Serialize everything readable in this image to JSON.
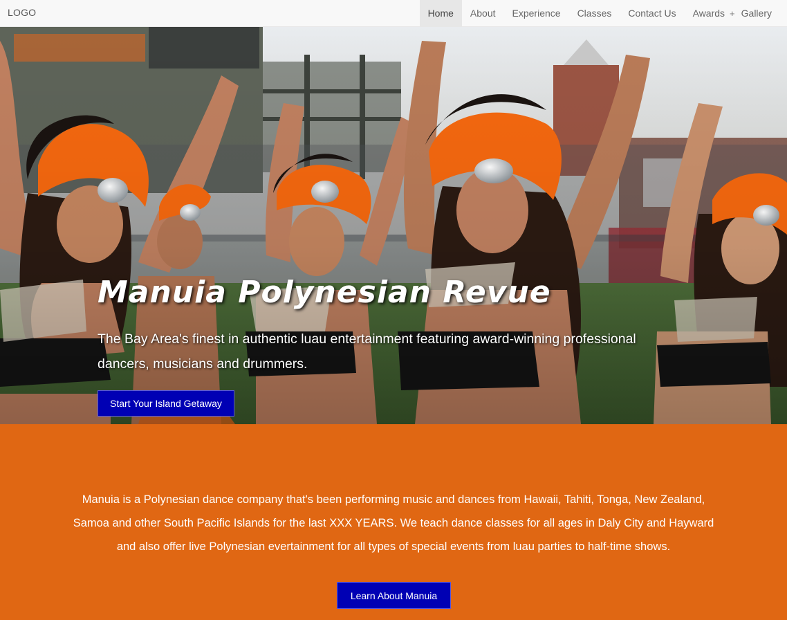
{
  "nav": {
    "logo": "LOGO",
    "items": [
      "Home",
      "About",
      "Experience",
      "Classes",
      "Contact Us",
      "Awards",
      "Gallery"
    ],
    "plus_symbol": "+",
    "active": "Home"
  },
  "hero": {
    "title": "Manuia Polynesian Revue",
    "tagline": "The Bay Area's finest in authentic luau entertainment featuring award-winning professional dancers, musicians and drummers.",
    "cta_label": "Start Your Island Getaway"
  },
  "about": {
    "text": "Manuia is a Polynesian dance company that's been performing music and dances from Hawaii, Tahiti, Tonga, New Zealand, Samoa and other South Pacific Islands for the last XXX YEARS. We teach dance classes for all ages in Daly City and Hayward and also offer live Polynesian evertainment for all types of special events from luau parties to half-time shows.",
    "cta_label": "Learn About Manuia"
  },
  "colors": {
    "accent_orange": "#e06713",
    "button_blue": "#0000b4",
    "headdress_orange": "#f5680f",
    "navbar_bg": "#f8f8f8"
  }
}
